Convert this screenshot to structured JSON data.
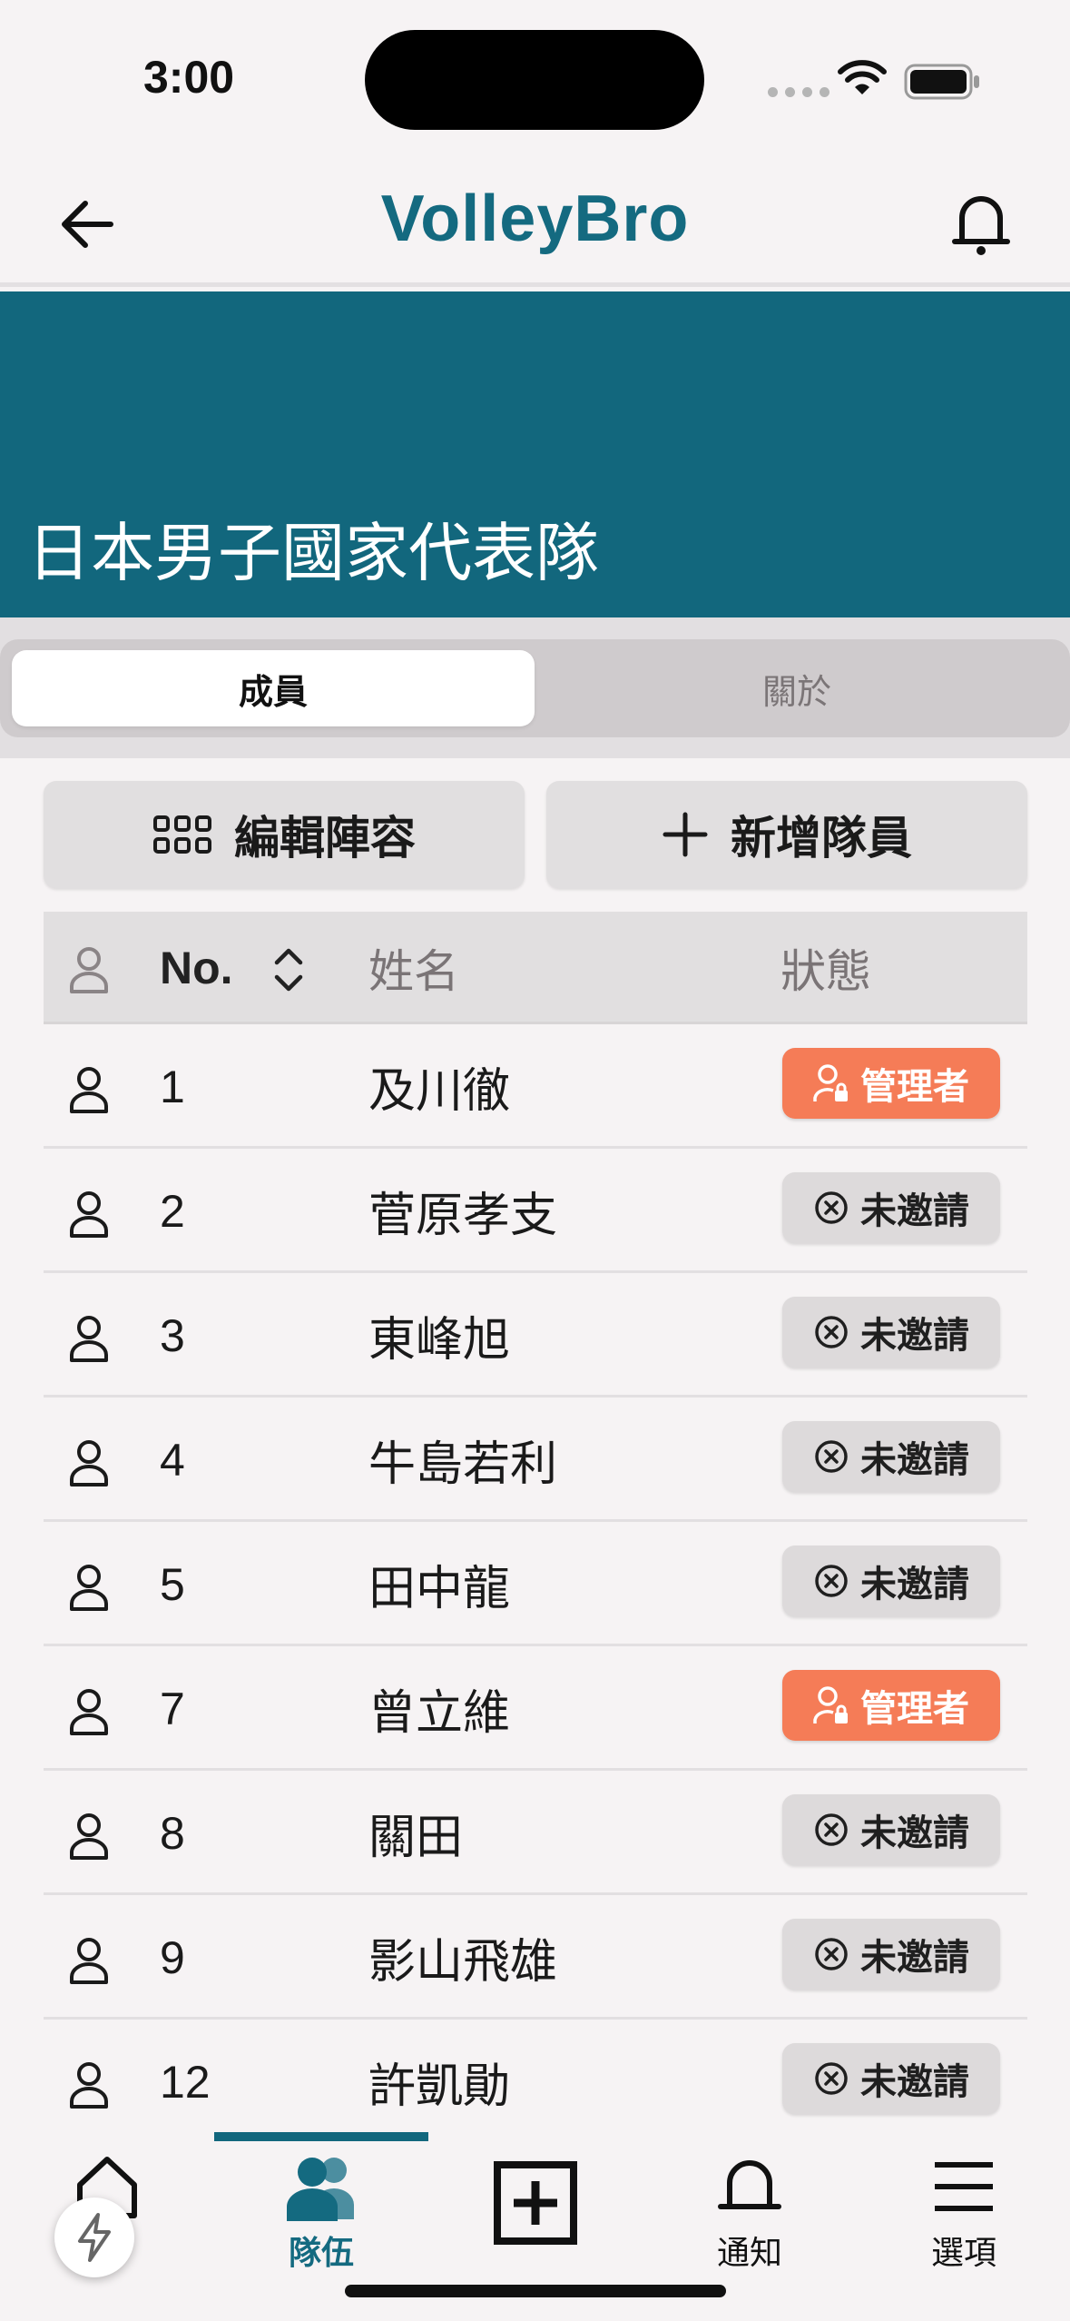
{
  "status_bar": {
    "time": "3:00"
  },
  "app_bar": {
    "title": "VolleyBro"
  },
  "team": {
    "name": "日本男子國家代表隊"
  },
  "tabs": [
    {
      "label": "成員",
      "active": true
    },
    {
      "label": "關於",
      "active": false
    }
  ],
  "actions": {
    "edit_lineup": "編輯陣容",
    "add_member": "新增隊員"
  },
  "table": {
    "headers": {
      "number": "No.",
      "name": "姓名",
      "status": "狀態"
    },
    "rows": [
      {
        "number": "1",
        "name": "及川徹",
        "status": "管理者",
        "type": "admin"
      },
      {
        "number": "2",
        "name": "菅原孝支",
        "status": "未邀請",
        "type": "uninvited"
      },
      {
        "number": "3",
        "name": "東峰旭",
        "status": "未邀請",
        "type": "uninvited"
      },
      {
        "number": "4",
        "name": "牛島若利",
        "status": "未邀請",
        "type": "uninvited"
      },
      {
        "number": "5",
        "name": "田中龍",
        "status": "未邀請",
        "type": "uninvited"
      },
      {
        "number": "7",
        "name": "曾立維",
        "status": "管理者",
        "type": "admin"
      },
      {
        "number": "8",
        "name": "關田",
        "status": "未邀請",
        "type": "uninvited"
      },
      {
        "number": "9",
        "name": "影山飛雄",
        "status": "未邀請",
        "type": "uninvited"
      },
      {
        "number": "12",
        "name": "許凱勛",
        "status": "未邀請",
        "type": "uninvited"
      }
    ]
  },
  "bottom_nav": {
    "items": [
      {
        "label": "",
        "icon": "home-icon"
      },
      {
        "label": "隊伍",
        "icon": "team-icon",
        "active": true
      },
      {
        "label": "",
        "icon": "add-square-icon"
      },
      {
        "label": "通知",
        "icon": "bell-icon"
      },
      {
        "label": "選項",
        "icon": "menu-icon"
      }
    ]
  },
  "colors": {
    "primary": "#12677d",
    "admin": "#f57c57",
    "badge_grey": "#dddadb"
  }
}
